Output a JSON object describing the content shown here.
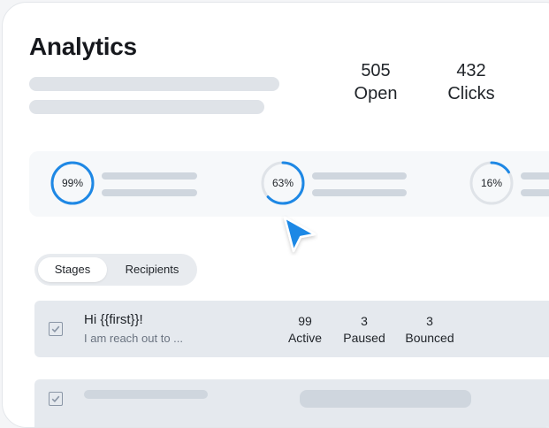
{
  "header": {
    "title": "Analytics"
  },
  "stats": [
    {
      "value": "505",
      "label": "Open"
    },
    {
      "value": "432",
      "label": "Clicks"
    }
  ],
  "rings": [
    {
      "label": "99%",
      "percent": 99,
      "color": "#1e88e5"
    },
    {
      "label": "63%",
      "percent": 63,
      "color": "#1e88e5"
    },
    {
      "label": "16%",
      "percent": 16,
      "color": "#1e88e5"
    }
  ],
  "tabs": [
    {
      "label": "Stages",
      "active": true
    },
    {
      "label": "Recipients",
      "active": false
    }
  ],
  "sequence": {
    "title": "Hi {{first}}!",
    "preview": "I am reach out to ...",
    "metrics": [
      {
        "value": "99",
        "label": "Active"
      },
      {
        "value": "3",
        "label": "Paused"
      },
      {
        "value": "3",
        "label": "Bounced"
      }
    ]
  },
  "colors": {
    "accent": "#1e88e5",
    "track": "#dfe3e8"
  }
}
